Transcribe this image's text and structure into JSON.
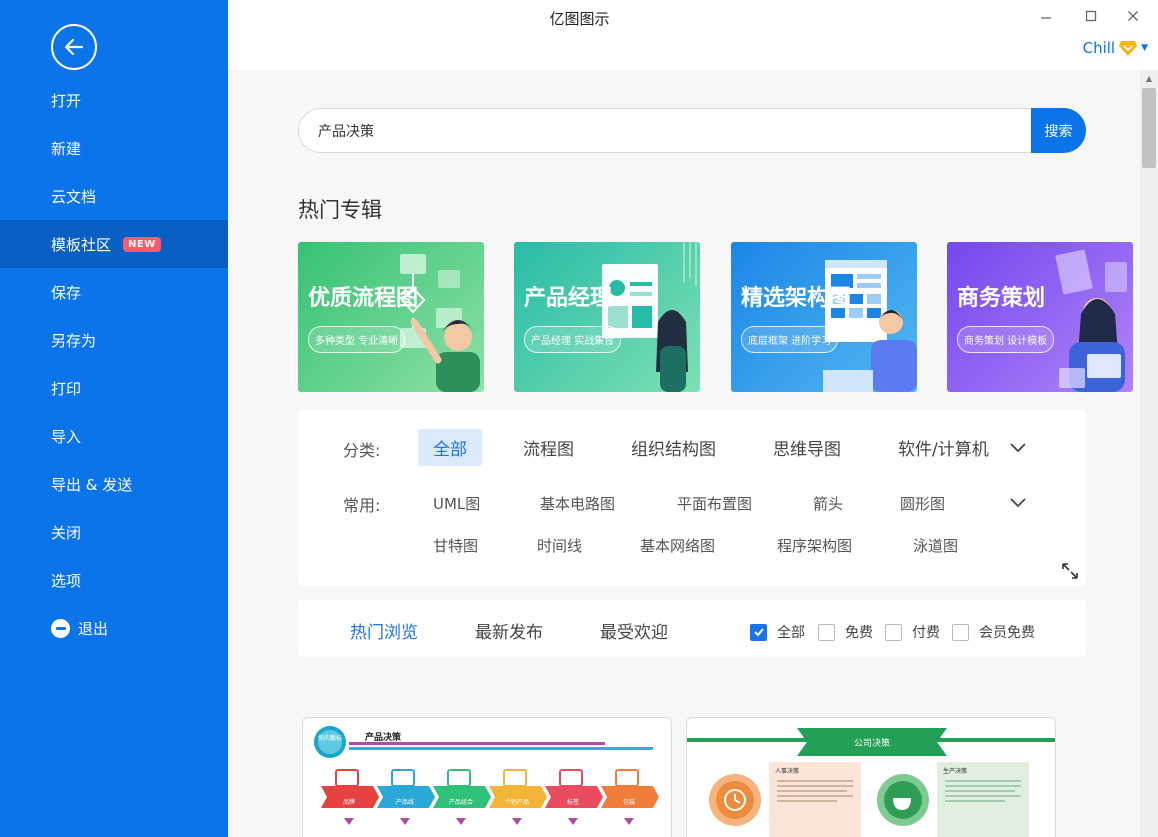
{
  "app": {
    "title": "亿图图示"
  },
  "window": {
    "minimize": "–",
    "maximize": "☐",
    "close": "✕"
  },
  "user": {
    "name": "Chill",
    "badge_icon": "diamond-icon"
  },
  "sidebar": {
    "back_icon": "arrow-left-icon",
    "items": [
      {
        "label": "打开"
      },
      {
        "label": "新建"
      },
      {
        "label": "云文档"
      },
      {
        "label": "模板社区",
        "badge": "NEW",
        "active": true
      },
      {
        "label": "保存"
      },
      {
        "label": "另存为"
      },
      {
        "label": "打印"
      },
      {
        "label": "导入"
      },
      {
        "label": "导出 & 发送"
      },
      {
        "label": "关闭"
      },
      {
        "label": "选项"
      },
      {
        "label": "退出",
        "icon": "minus-circle-icon"
      }
    ]
  },
  "search": {
    "value": "产品决策",
    "button": "搜索"
  },
  "hot": {
    "title": "热门专辑",
    "banners": [
      {
        "title": "优质流程图",
        "subtitle": "多种类型 专业清晰",
        "color1": "#3ec77a",
        "color2": "#7ddc9c"
      },
      {
        "title": "产品经理",
        "subtitle": "产品经理 实战集合",
        "color1": "#2fbfa9",
        "color2": "#6fdcb4"
      },
      {
        "title": "精选架构图",
        "subtitle": "底层框架 进阶学习",
        "color1": "#1f8fe8",
        "color2": "#4fb4f0"
      },
      {
        "title": "商务策划",
        "subtitle": "商务策划 设计模板",
        "color1": "#7a4ef0",
        "color2": "#a678f7"
      }
    ]
  },
  "categories": {
    "label": "分类:",
    "items": [
      "全部",
      "流程图",
      "组织结构图",
      "思维导图",
      "软件/计算机"
    ],
    "common_label": "常用:",
    "common_row1": [
      "UML图",
      "基本电路图",
      "平面布置图",
      "箭头",
      "圆形图"
    ],
    "common_row2": [
      "甘特图",
      "时间线",
      "基本网络图",
      "程序架构图",
      "泳道图"
    ]
  },
  "tabs": {
    "items": [
      "热门浏览",
      "最新发布",
      "最受欢迎"
    ],
    "filters": [
      {
        "label": "全部",
        "checked": true
      },
      {
        "label": "免费",
        "checked": false
      },
      {
        "label": "付费",
        "checked": false
      },
      {
        "label": "会员免费",
        "checked": false
      }
    ]
  },
  "templates": [
    {
      "title": "产品决策",
      "badge": "你的徽标",
      "steps": [
        "品牌",
        "产品线",
        "产品组合",
        "个别产品",
        "标签",
        "包装"
      ]
    },
    {
      "title": "公司决策",
      "box1": "人事决策",
      "box2": "生产决策"
    }
  ],
  "colors": {
    "accent": "#0b74e8",
    "sidebar_active": "#0a5fc4",
    "new_badge": "#ff5a6a"
  }
}
